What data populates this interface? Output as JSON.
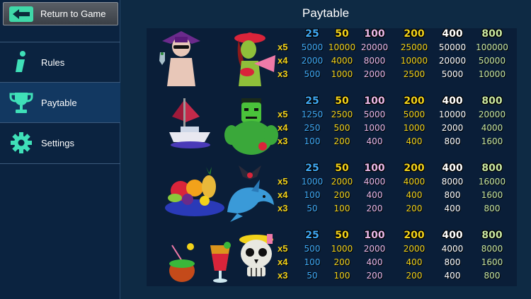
{
  "sidebar": {
    "return_label": "Return to Game",
    "items": [
      {
        "label": "Rules",
        "icon": "info-icon"
      },
      {
        "label": "Paytable",
        "icon": "trophy-icon",
        "active": true
      },
      {
        "label": "Settings",
        "icon": "gear-icon"
      }
    ]
  },
  "title": "Paytable",
  "bets": [
    "25",
    "50",
    "100",
    "200",
    "400",
    "800"
  ],
  "bet_colors": [
    "#3fa9f5",
    "#f2d21a",
    "#e9b8e8",
    "#f2d21a",
    "#ffffff",
    "#c8e6a0"
  ],
  "column_colors": [
    "#3fa9f5",
    "#f2d21a",
    "#e9b8e8",
    "#f2d21a",
    "#ffffff",
    "#c8e6a0"
  ],
  "groups": [
    {
      "symbols": [
        "vampire-character-icon",
        "witch-character-icon"
      ],
      "multipliers": [
        "x5",
        "x4",
        "x3"
      ],
      "rows": [
        [
          "5000",
          "10000",
          "20000",
          "25000",
          "50000",
          "100000"
        ],
        [
          "2000",
          "4000",
          "8000",
          "10000",
          "20000",
          "50000"
        ],
        [
          "500",
          "1000",
          "2000",
          "2500",
          "5000",
          "10000"
        ]
      ]
    },
    {
      "symbols": [
        "yacht-icon",
        "frankenstein-character-icon"
      ],
      "multipliers": [
        "x5",
        "x4",
        "x3"
      ],
      "rows": [
        [
          "1250",
          "2500",
          "5000",
          "5000",
          "10000",
          "20000"
        ],
        [
          "250",
          "500",
          "1000",
          "1000",
          "2000",
          "4000"
        ],
        [
          "100",
          "200",
          "400",
          "400",
          "800",
          "1600"
        ]
      ]
    },
    {
      "symbols": [
        "fruit-plate-icon",
        "dolphin-bat-icon"
      ],
      "multipliers": [
        "x5",
        "x4",
        "x3"
      ],
      "rows": [
        [
          "1000",
          "2000",
          "4000",
          "4000",
          "8000",
          "16000"
        ],
        [
          "100",
          "200",
          "400",
          "400",
          "800",
          "1600"
        ],
        [
          "50",
          "100",
          "200",
          "200",
          "400",
          "800"
        ]
      ]
    },
    {
      "symbols": [
        "coconut-drink-icon",
        "cocktail-icon",
        "skull-icon"
      ],
      "multipliers": [
        "x5",
        "x4",
        "x3"
      ],
      "rows": [
        [
          "500",
          "1000",
          "2000",
          "2000",
          "4000",
          "8000"
        ],
        [
          "100",
          "200",
          "400",
          "400",
          "800",
          "1600"
        ],
        [
          "50",
          "100",
          "200",
          "200",
          "400",
          "800"
        ]
      ]
    }
  ]
}
